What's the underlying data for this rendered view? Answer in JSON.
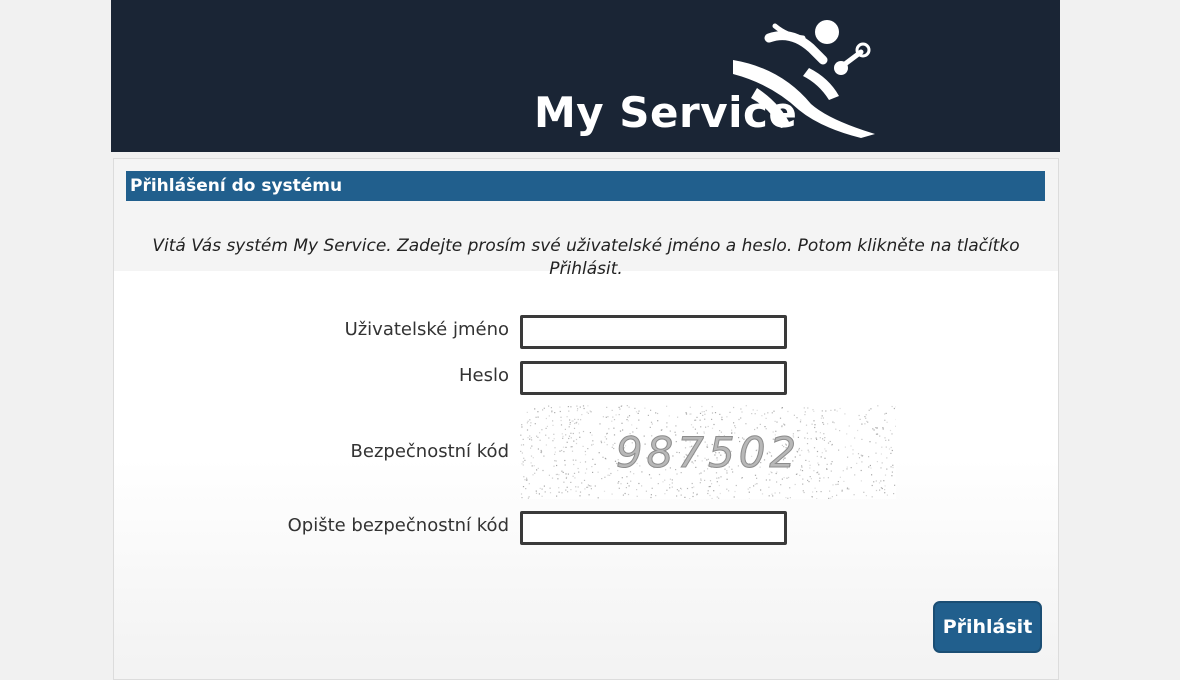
{
  "header": {
    "logo_text": "My Service",
    "background": "#1a2535"
  },
  "panel": {
    "title": "Přihlášení do systému",
    "intro": "Vitá Vás systém My Service. Zadejte prosím své uživatelské jméno a heslo. Potom klikněte na tlačítko Přihlásit.",
    "accent": "#215f8d"
  },
  "form": {
    "username_label": "Uživatelské jméno",
    "username_value": "",
    "password_label": "Heslo",
    "password_value": "",
    "captcha_label": "Bezpečnostní kód",
    "captcha_text": "987502",
    "captcha_input_label": "Opište bezpečnostní kód",
    "captcha_input_value": "",
    "submit_label": "Přihlásit"
  }
}
